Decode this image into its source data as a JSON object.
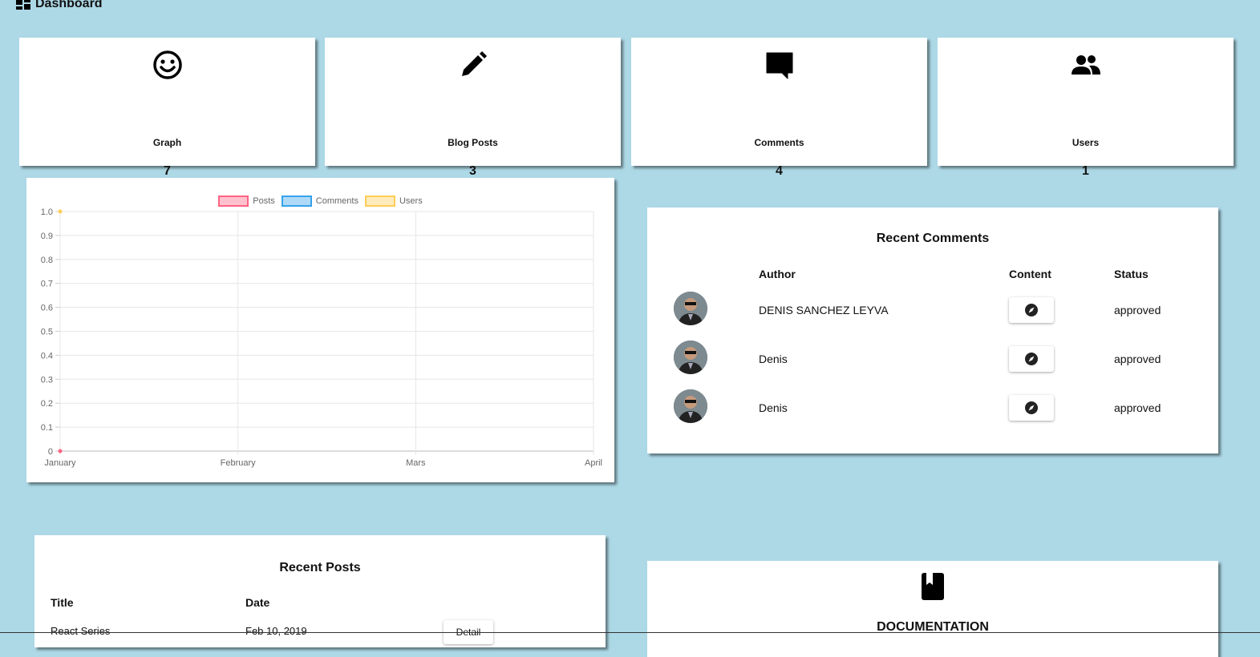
{
  "header": {
    "title": "Dashboard",
    "icon": "dashboard-icon"
  },
  "stats": [
    {
      "icon": "smiley-icon",
      "label": "Graph",
      "count": "7"
    },
    {
      "icon": "pencil-icon",
      "label": "Blog Posts",
      "count": "3"
    },
    {
      "icon": "comment-icon",
      "label": "Comments",
      "count": "4"
    },
    {
      "icon": "users-icon",
      "label": "Users",
      "count": "1"
    }
  ],
  "chart_data": {
    "type": "line",
    "categories": [
      "January",
      "February",
      "Mars",
      "April"
    ],
    "series": [
      {
        "name": "Posts",
        "color": "#ff6384",
        "values": [
          0
        ]
      },
      {
        "name": "Comments",
        "color": "#36a2eb",
        "values": []
      },
      {
        "name": "Users",
        "color": "#ffcd56",
        "values": [
          1
        ]
      }
    ],
    "yticks": [
      "1.0",
      "0.9",
      "0.8",
      "0.7",
      "0.6",
      "0.5",
      "0.4",
      "0.3",
      "0.2",
      "0.1",
      "0"
    ],
    "ylim": [
      0,
      1
    ],
    "grid": true,
    "legend": "top"
  },
  "recent_comments": {
    "title": "Recent Comments",
    "columns": {
      "author": "Author",
      "content": "Content",
      "status": "Status"
    },
    "rows": [
      {
        "author": "DENIS SANCHEZ LEYVA",
        "status": "approved"
      },
      {
        "author": "Denis",
        "status": "approved"
      },
      {
        "author": "Denis",
        "status": "approved"
      }
    ]
  },
  "recent_posts": {
    "title": "Recent Posts",
    "columns": {
      "title": "Title",
      "date": "Date"
    },
    "rows": [
      {
        "title": "React Series",
        "date": "Feb 10, 2019",
        "action": "Detail"
      }
    ]
  },
  "documentation": {
    "title": "DOCUMENTATION",
    "icon": "book-icon"
  },
  "colors": {
    "background": "#add8e6",
    "card": "#ffffff"
  }
}
